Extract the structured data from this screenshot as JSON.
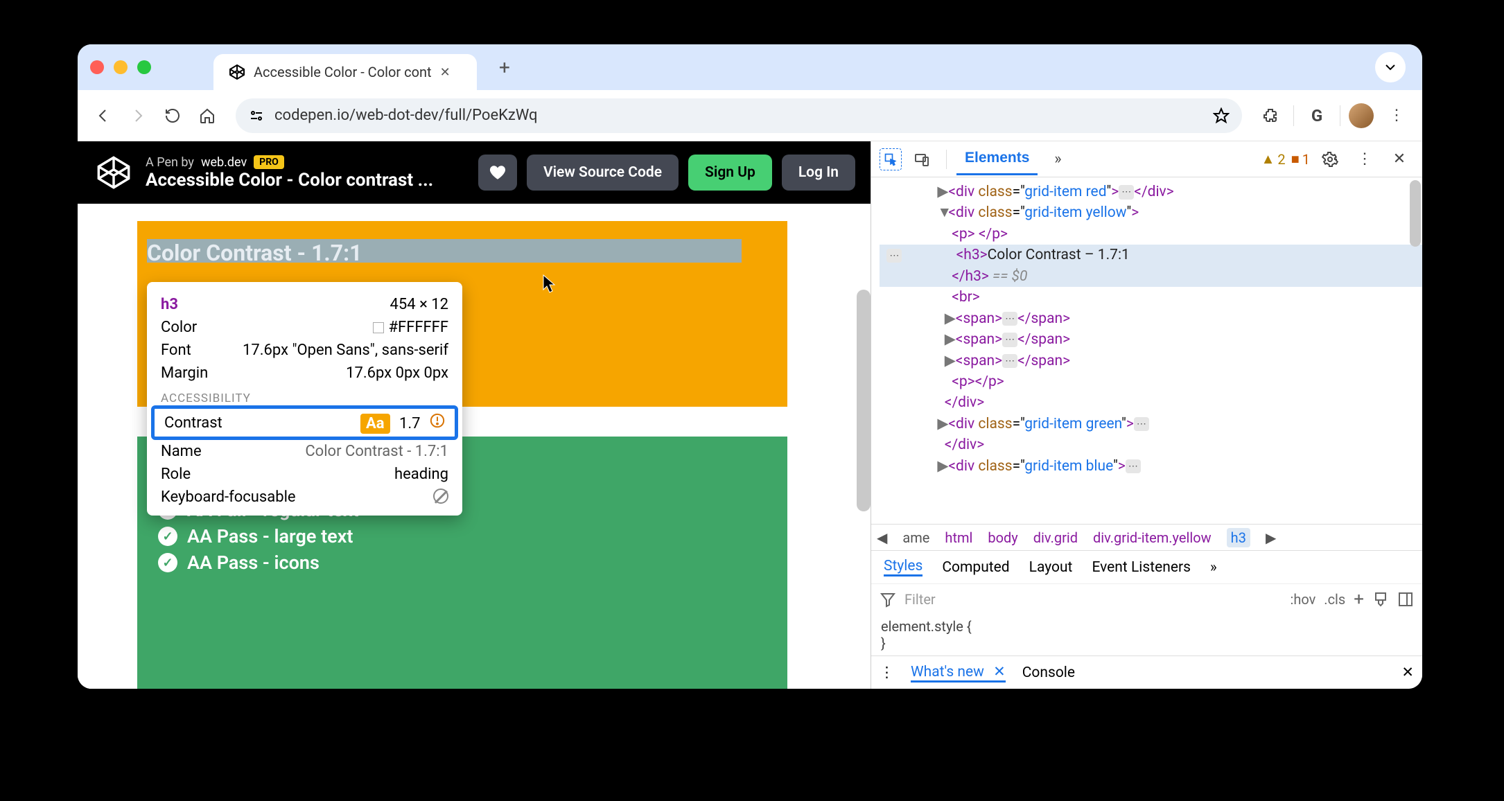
{
  "browser": {
    "tab_title": "Accessible Color - Color cont",
    "url": "codepen.io/web-dot-dev/full/PoeKzWq"
  },
  "codepen": {
    "byline_prefix": "A Pen by",
    "author": "web.dev",
    "pro_badge": "PRO",
    "pen_title": "Accessible Color - Color contrast ...",
    "btn_view_source": "View Source Code",
    "btn_signup": "Sign Up",
    "btn_login": "Log In"
  },
  "page": {
    "heading": "Color Contrast - 1.7:1",
    "green_lines": [
      {
        "status": "fail",
        "text": "AA Fail - regular text"
      },
      {
        "status": "pass",
        "text": "AA Pass - large text"
      },
      {
        "status": "pass",
        "text": "AA Pass - icons"
      }
    ]
  },
  "tooltip": {
    "tag": "h3",
    "dimensions": "454 × 12",
    "rows": [
      {
        "label": "Color",
        "value": "#FFFFFF",
        "swatch": true
      },
      {
        "label": "Font",
        "value": "17.6px \"Open Sans\", sans-serif"
      },
      {
        "label": "Margin",
        "value": "17.6px 0px 0px"
      }
    ],
    "section_label": "ACCESSIBILITY",
    "contrast_label": "Contrast",
    "contrast_badge": "Aa",
    "contrast_value": "1.7",
    "a11y_rows": [
      {
        "label": "Name",
        "value": "Color Contrast - 1.7:1"
      },
      {
        "label": "Role",
        "value": "heading"
      },
      {
        "label": "Keyboard-focusable",
        "value": "forbid"
      }
    ]
  },
  "devtools": {
    "toolbar_tabs": {
      "elements": "Elements"
    },
    "issues_warning_count": "2",
    "issues_error_count": "1",
    "elements_html": {
      "l1": {
        "class": "grid-item red"
      },
      "l2": {
        "class": "grid-item yellow"
      },
      "l3_text": "Color Contrast – 1.7:1",
      "l3_suffix": " == $0",
      "l4_green": {
        "class": "grid-item green"
      },
      "l5_blue": {
        "class": "grid-item blue"
      }
    },
    "breadcrumbs": [
      "ame",
      "html",
      "body",
      "div.grid",
      "div.grid-item.yellow",
      "h3"
    ],
    "styles_tabs": [
      "Styles",
      "Computed",
      "Layout",
      "Event Listeners"
    ],
    "filter_placeholder": "Filter",
    "filter_actions": [
      ":hov",
      ".cls"
    ],
    "element_style_open": "element.style {",
    "element_style_close": "}",
    "drawer_tabs": [
      "What's new",
      "Console"
    ]
  }
}
